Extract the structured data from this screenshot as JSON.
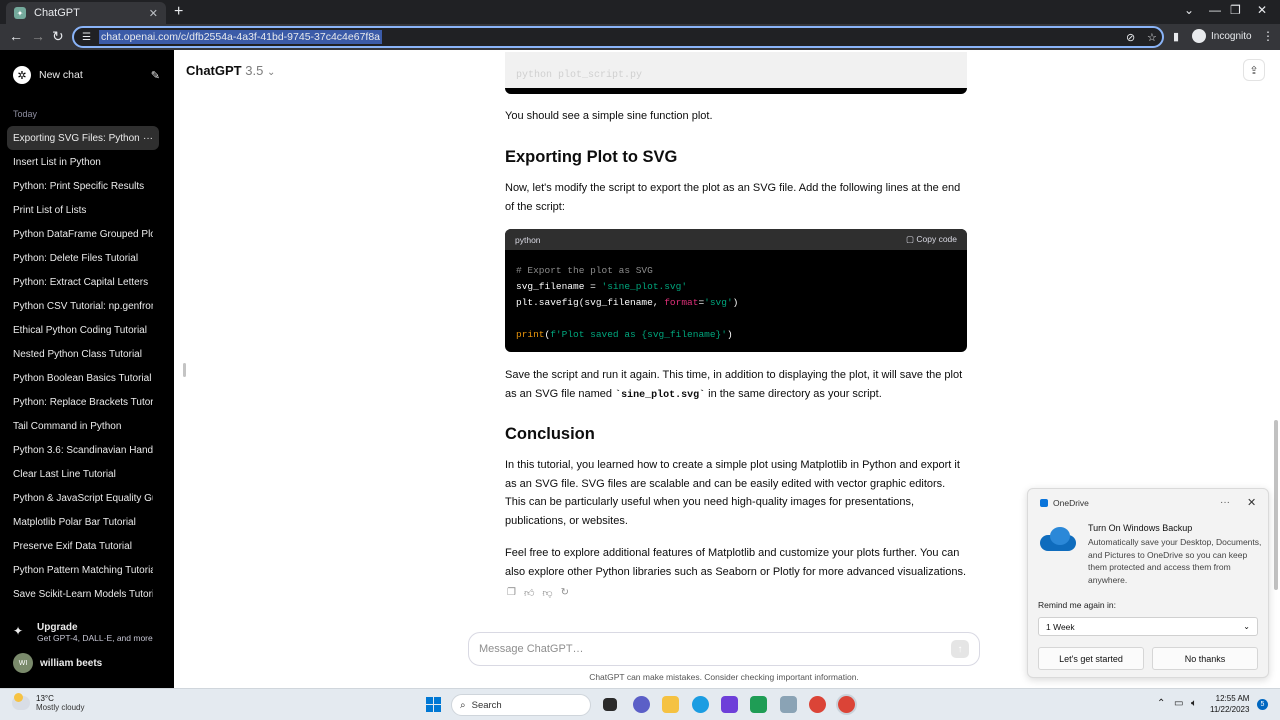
{
  "browser": {
    "tab_title": "ChatGPT",
    "url": "chat.openai.com/c/dfb2554a-4a3f-41bd-9745-37c4c4e67f8a",
    "profile_label": "Incognito"
  },
  "sidebar": {
    "new_chat": "New chat",
    "section_label": "Today",
    "items": [
      "Exporting SVG Files: Python",
      "Insert List in Python",
      "Python: Print Specific Results",
      "Print List of Lists",
      "Python DataFrame Grouped Plot",
      "Python: Delete Files Tutorial",
      "Python: Extract Capital Letters",
      "Python CSV Tutorial: np.genfromt",
      "Ethical Python Coding Tutorial",
      "Nested Python Class Tutorial",
      "Python Boolean Basics Tutorial",
      "Python: Replace Brackets Tutoria",
      "Tail Command in Python",
      "Python 3.6: Scandinavian Handlin",
      "Clear Last Line Tutorial",
      "Python & JavaScript Equality Gui",
      "Matplotlib Polar Bar Tutorial",
      "Preserve Exif Data Tutorial",
      "Python Pattern Matching Tutorial",
      "Save Scikit-Learn Models Tutoria"
    ],
    "upgrade_title": "Upgrade",
    "upgrade_sub": "Get GPT-4, DALL·E, and more",
    "user_initials": "WI",
    "user_name": "william beets"
  },
  "main": {
    "model_name": "ChatGPT",
    "model_version": "3.5",
    "prev_code_tail": "python plot_script.py",
    "p1": "You should see a simple sine function plot.",
    "h_export": "Exporting Plot to SVG",
    "p2": "Now, let's modify the script to export the plot as an SVG file. Add the following lines at the end of the script:",
    "code_lang": "python",
    "copy_label": "Copy code",
    "code": {
      "l1": "# Export the plot as SVG",
      "l2a": "svg_filename = ",
      "l2b": "'sine_plot.svg'",
      "l3a": "plt.savefig(svg_filename, ",
      "l3b": "format",
      "l3c": "=",
      "l3d": "'svg'",
      "l3e": ")",
      "l5a": "print",
      "l5b": "(",
      "l5c": "f'Plot saved as {svg_filename}'",
      "l5d": ")"
    },
    "p3_a": "Save the script and run it again. This time, in addition to displaying the plot, it will save the plot as an SVG file named ",
    "p3_code": "`sine_plot.svg`",
    "p3_b": " in the same directory as your script.",
    "h_conclusion": "Conclusion",
    "p4": "In this tutorial, you learned how to create a simple plot using Matplotlib in Python and export it as an SVG file. SVG files are scalable and can be easily edited with vector graphic editors. This can be particularly useful when you need high-quality images for presentations, publications, or websites.",
    "p5": "Feel free to explore additional features of Matplotlib and customize your plots further. You can also explore other Python libraries such as Seaborn or Plotly for more advanced visualizations.",
    "composer_placeholder": "Message ChatGPT…",
    "disclaimer": "ChatGPT can make mistakes. Consider checking important information."
  },
  "toast": {
    "app": "OneDrive",
    "title": "Turn On Windows Backup",
    "body": "Automatically save your Desktop, Documents, and Pictures to OneDrive so you can keep them protected and access them from anywhere.",
    "remind_label": "Remind me again in:",
    "remind_value": "1 Week",
    "primary": "Let's get started",
    "secondary": "No thanks"
  },
  "taskbar": {
    "temp": "13°C",
    "condition": "Mostly cloudy",
    "search": "Search",
    "time": "12:55 AM",
    "date": "11/22/2023",
    "notifications": "5"
  },
  "colors": {
    "sidebar_bg": "#000000",
    "accent": "#0078d4"
  }
}
